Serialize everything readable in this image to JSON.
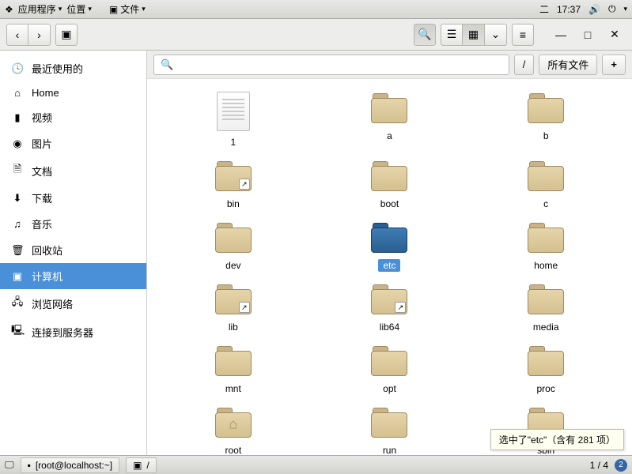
{
  "topbar": {
    "apps": "应用程序",
    "places": "位置",
    "filemenu": "文件",
    "day": "二",
    "time": "17:37"
  },
  "toolbar": {
    "back": "‹",
    "forward": "›"
  },
  "search": {
    "path": "/",
    "filter": "所有文件",
    "plus": "+"
  },
  "sidebar": [
    {
      "icon": "🕓",
      "label": "最近使用的",
      "id": "recent"
    },
    {
      "icon": "⌂",
      "label": "Home",
      "id": "home"
    },
    {
      "icon": "▮",
      "label": "视频",
      "id": "videos"
    },
    {
      "icon": "◉",
      "label": "图片",
      "id": "pictures"
    },
    {
      "icon": "🗎",
      "label": "文档",
      "id": "documents"
    },
    {
      "icon": "⬇",
      "label": "下载",
      "id": "downloads"
    },
    {
      "icon": "♫",
      "label": "音乐",
      "id": "music"
    },
    {
      "icon": "🗑",
      "label": "回收站",
      "id": "trash"
    },
    {
      "icon": "▣",
      "label": "计算机",
      "id": "computer",
      "active": true
    },
    {
      "icon": "🖧",
      "label": "浏览网络",
      "id": "network"
    },
    {
      "icon": "🖳",
      "label": "连接到服务器",
      "id": "connect"
    }
  ],
  "items": [
    {
      "name": "1",
      "type": "file"
    },
    {
      "name": "a",
      "type": "folder"
    },
    {
      "name": "b",
      "type": "folder"
    },
    {
      "name": "bin",
      "type": "folder",
      "link": true
    },
    {
      "name": "boot",
      "type": "folder"
    },
    {
      "name": "c",
      "type": "folder"
    },
    {
      "name": "dev",
      "type": "folder"
    },
    {
      "name": "etc",
      "type": "folder",
      "selected": true
    },
    {
      "name": "home",
      "type": "folder"
    },
    {
      "name": "lib",
      "type": "folder",
      "link": true
    },
    {
      "name": "lib64",
      "type": "folder",
      "link": true
    },
    {
      "name": "media",
      "type": "folder"
    },
    {
      "name": "mnt",
      "type": "folder"
    },
    {
      "name": "opt",
      "type": "folder"
    },
    {
      "name": "proc",
      "type": "folder"
    },
    {
      "name": "root",
      "type": "folder",
      "home": true
    },
    {
      "name": "run",
      "type": "folder"
    },
    {
      "name": "sbin",
      "type": "folder"
    }
  ],
  "tooltip": "选中了\"etc\"（含有 281 项）",
  "taskbar": {
    "term": "[root@localhost:~]",
    "fm": "/",
    "pager": "1 / 4",
    "ws": "2"
  }
}
